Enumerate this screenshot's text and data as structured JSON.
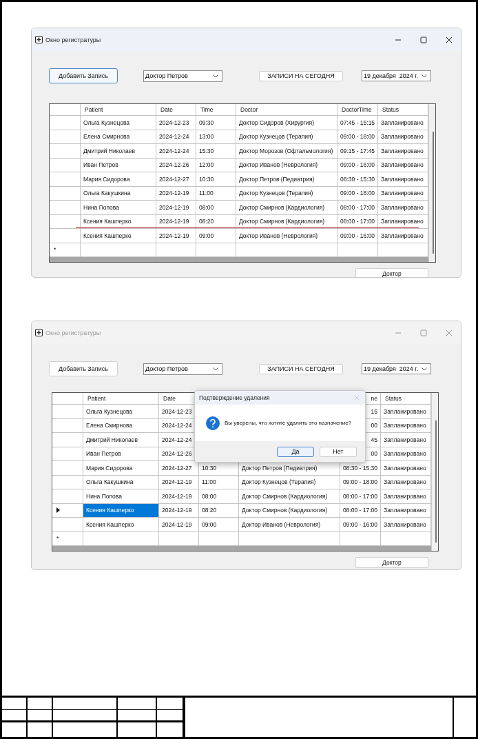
{
  "windows": [
    {
      "title": "Окно регистратуры",
      "active": true,
      "add_button": {
        "label": "Добавить Запись",
        "focused": true
      },
      "doctor_select": {
        "value": "Доктор Петров"
      },
      "today_button": {
        "label": "ЗАПИСИ НА СЕГОДНЯ"
      },
      "date_picker": {
        "value": "19 декабря  2024 г."
      },
      "table": {
        "columns": [
          {
            "label": "Patient"
          },
          {
            "label": "Date"
          },
          {
            "label": "Time"
          },
          {
            "label": "Doctor"
          },
          {
            "label": "DoctorTime",
            "cut_left": false
          },
          {
            "label": "Status"
          }
        ],
        "rows": [
          {
            "selected": false,
            "underlined": false,
            "cells": {
              "patient": "Ольга Кузнецова",
              "date": "2024-12-23",
              "time": "09:30",
              "doctor": "Доктор Сидоров (Хирургия)",
              "doctor_time": "07:45 - 15:15",
              "status": "Запланировано"
            }
          },
          {
            "selected": false,
            "underlined": false,
            "cells": {
              "patient": "Елена Смирнова",
              "date": "2024-12-24",
              "time": "13:00",
              "doctor": "Доктор Кузнецов (Терапия)",
              "doctor_time": "09:00 - 18:00",
              "status": "Запланировано"
            }
          },
          {
            "selected": false,
            "underlined": false,
            "cells": {
              "patient": "Дмитрий Николаев",
              "date": "2024-12-24",
              "time": "15:30",
              "doctor": "Доктор Морозов (Офтальмология)",
              "doctor_time": "09:15 - 17:45",
              "status": "Запланировано"
            }
          },
          {
            "selected": false,
            "underlined": false,
            "cells": {
              "patient": "Иван Петров",
              "date": "2024-12-26",
              "time": "12:00",
              "doctor": "Доктор Иванов (Неврология)",
              "doctor_time": "09:00 - 16:00",
              "status": "Запланировано"
            }
          },
          {
            "selected": false,
            "underlined": false,
            "cells": {
              "patient": "Мария Сидорова",
              "date": "2024-12-27",
              "time": "10:30",
              "doctor": "Доктор Петров (Педиатрия)",
              "doctor_time": "08:30 - 15:30",
              "status": "Запланировано"
            }
          },
          {
            "selected": false,
            "underlined": false,
            "cells": {
              "patient": "Ольга Какушкина",
              "date": "2024-12-19",
              "time": "11:00",
              "doctor": "Доктор Кузнецов (Терапия)",
              "doctor_time": "09:00 - 18:00",
              "status": "Запланировано"
            }
          },
          {
            "selected": false,
            "underlined": false,
            "cells": {
              "patient": "Нина Попова",
              "date": "2024-12-19",
              "time": "08:00",
              "doctor": "Доктор Смирнов (Кардиология)",
              "doctor_time": "08:00 - 17:00",
              "status": "Запланировано"
            }
          },
          {
            "selected": false,
            "underlined": true,
            "cells": {
              "patient": "Ксения Кашперко",
              "date": "2024-12-19",
              "time": "08:20",
              "doctor": "Доктор Смирнов (Кардиология)",
              "doctor_time": "08:00 - 17:00",
              "status": "Запланировано"
            }
          },
          {
            "selected": false,
            "underlined": false,
            "cells": {
              "patient": "Ксения Кашперко",
              "date": "2024-12-19",
              "time": "09:00",
              "doctor": "Доктор Иванов (Неврология)",
              "doctor_time": "09:00 - 16:00",
              "status": "Запланировано"
            }
          }
        ],
        "new_row_marker": "*"
      },
      "doctor_button": {
        "label": "Доктор"
      }
    },
    {
      "title": "Окно регистратуры",
      "active": false,
      "add_button": {
        "label": "Добавить Запись",
        "focused": false
      },
      "doctor_select": {
        "value": "Доктор Петров"
      },
      "today_button": {
        "label": "ЗАПИСИ НА СЕГОДНЯ"
      },
      "date_picker": {
        "value": "19 декабря  2024 г."
      },
      "table": {
        "columns": [
          {
            "label": "Patient"
          },
          {
            "label": "Date"
          },
          {},
          {},
          {
            "label": "ne",
            "cut_left": true
          },
          {
            "label": "Status"
          }
        ],
        "rows": [
          {
            "selected": false,
            "underlined": false,
            "cells": {
              "patient": "Ольга Кузнецова",
              "date": "2024-12-23",
              "doctor_time": "15",
              "status": "Запланировано"
            }
          },
          {
            "selected": false,
            "underlined": false,
            "cells": {
              "patient": "Елена Смирнова",
              "date": "2024-12-24",
              "doctor_time": "00",
              "status": "Запланировано"
            }
          },
          {
            "selected": false,
            "underlined": false,
            "cells": {
              "patient": "Дмитрий Николаев",
              "date": "2024-12-24",
              "doctor_time": "45",
              "status": "Запланировано"
            }
          },
          {
            "selected": false,
            "underlined": false,
            "cells": {
              "patient": "Иван Петров",
              "date": "2024-12-26",
              "doctor_time": "00",
              "status": "Запланировано"
            }
          },
          {
            "selected": false,
            "underlined": false,
            "cells": {
              "patient": "Мария Сидорова",
              "date": "2024-12-27",
              "time": "10:30",
              "doctor": "Доктор Петров (Педиатрия)",
              "doctor_time": "08:30 - 15:30",
              "status": "Запланировано"
            }
          },
          {
            "selected": false,
            "underlined": false,
            "cells": {
              "patient": "Ольга Какушкина",
              "date": "2024-12-19",
              "time": "11:00",
              "doctor": "Доктор Кузнецов (Терапия)",
              "doctor_time": "09:00 - 18:00",
              "status": "Запланировано"
            }
          },
          {
            "selected": false,
            "underlined": false,
            "cells": {
              "patient": "Нина Попова",
              "date": "2024-12-19",
              "time": "08:00",
              "doctor": "Доктор Смирнов (Кардиология)",
              "doctor_time": "08:00 - 17:00",
              "status": "Запланировано"
            }
          },
          {
            "selected": true,
            "underlined": false,
            "cells": {
              "patient": "Ксения Кашперко",
              "date": "2024-12-19",
              "time": "08:20",
              "doctor": "Доктор Смирнов (Кардиология)",
              "doctor_time": "08:00 - 17:00",
              "status": "Запланировано"
            }
          },
          {
            "selected": false,
            "underlined": false,
            "cells": {
              "patient": "Ксения Кашперко",
              "date": "2024-12-19",
              "time": "09:00",
              "doctor": "Доктор Иванов (Неврология)",
              "doctor_time": "09:00 - 16:00",
              "status": "Запланировано"
            }
          }
        ],
        "new_row_marker": "*"
      },
      "doctor_button": {
        "label": "Доктор"
      },
      "dialog": {
        "title": "Подтверждение удаления",
        "message": "Вы уверены, что хотите удалить это назначение?",
        "buttons": [
          {
            "label": "Да",
            "focused": true
          },
          {
            "label": "Нет",
            "focused": false
          }
        ]
      }
    }
  ]
}
